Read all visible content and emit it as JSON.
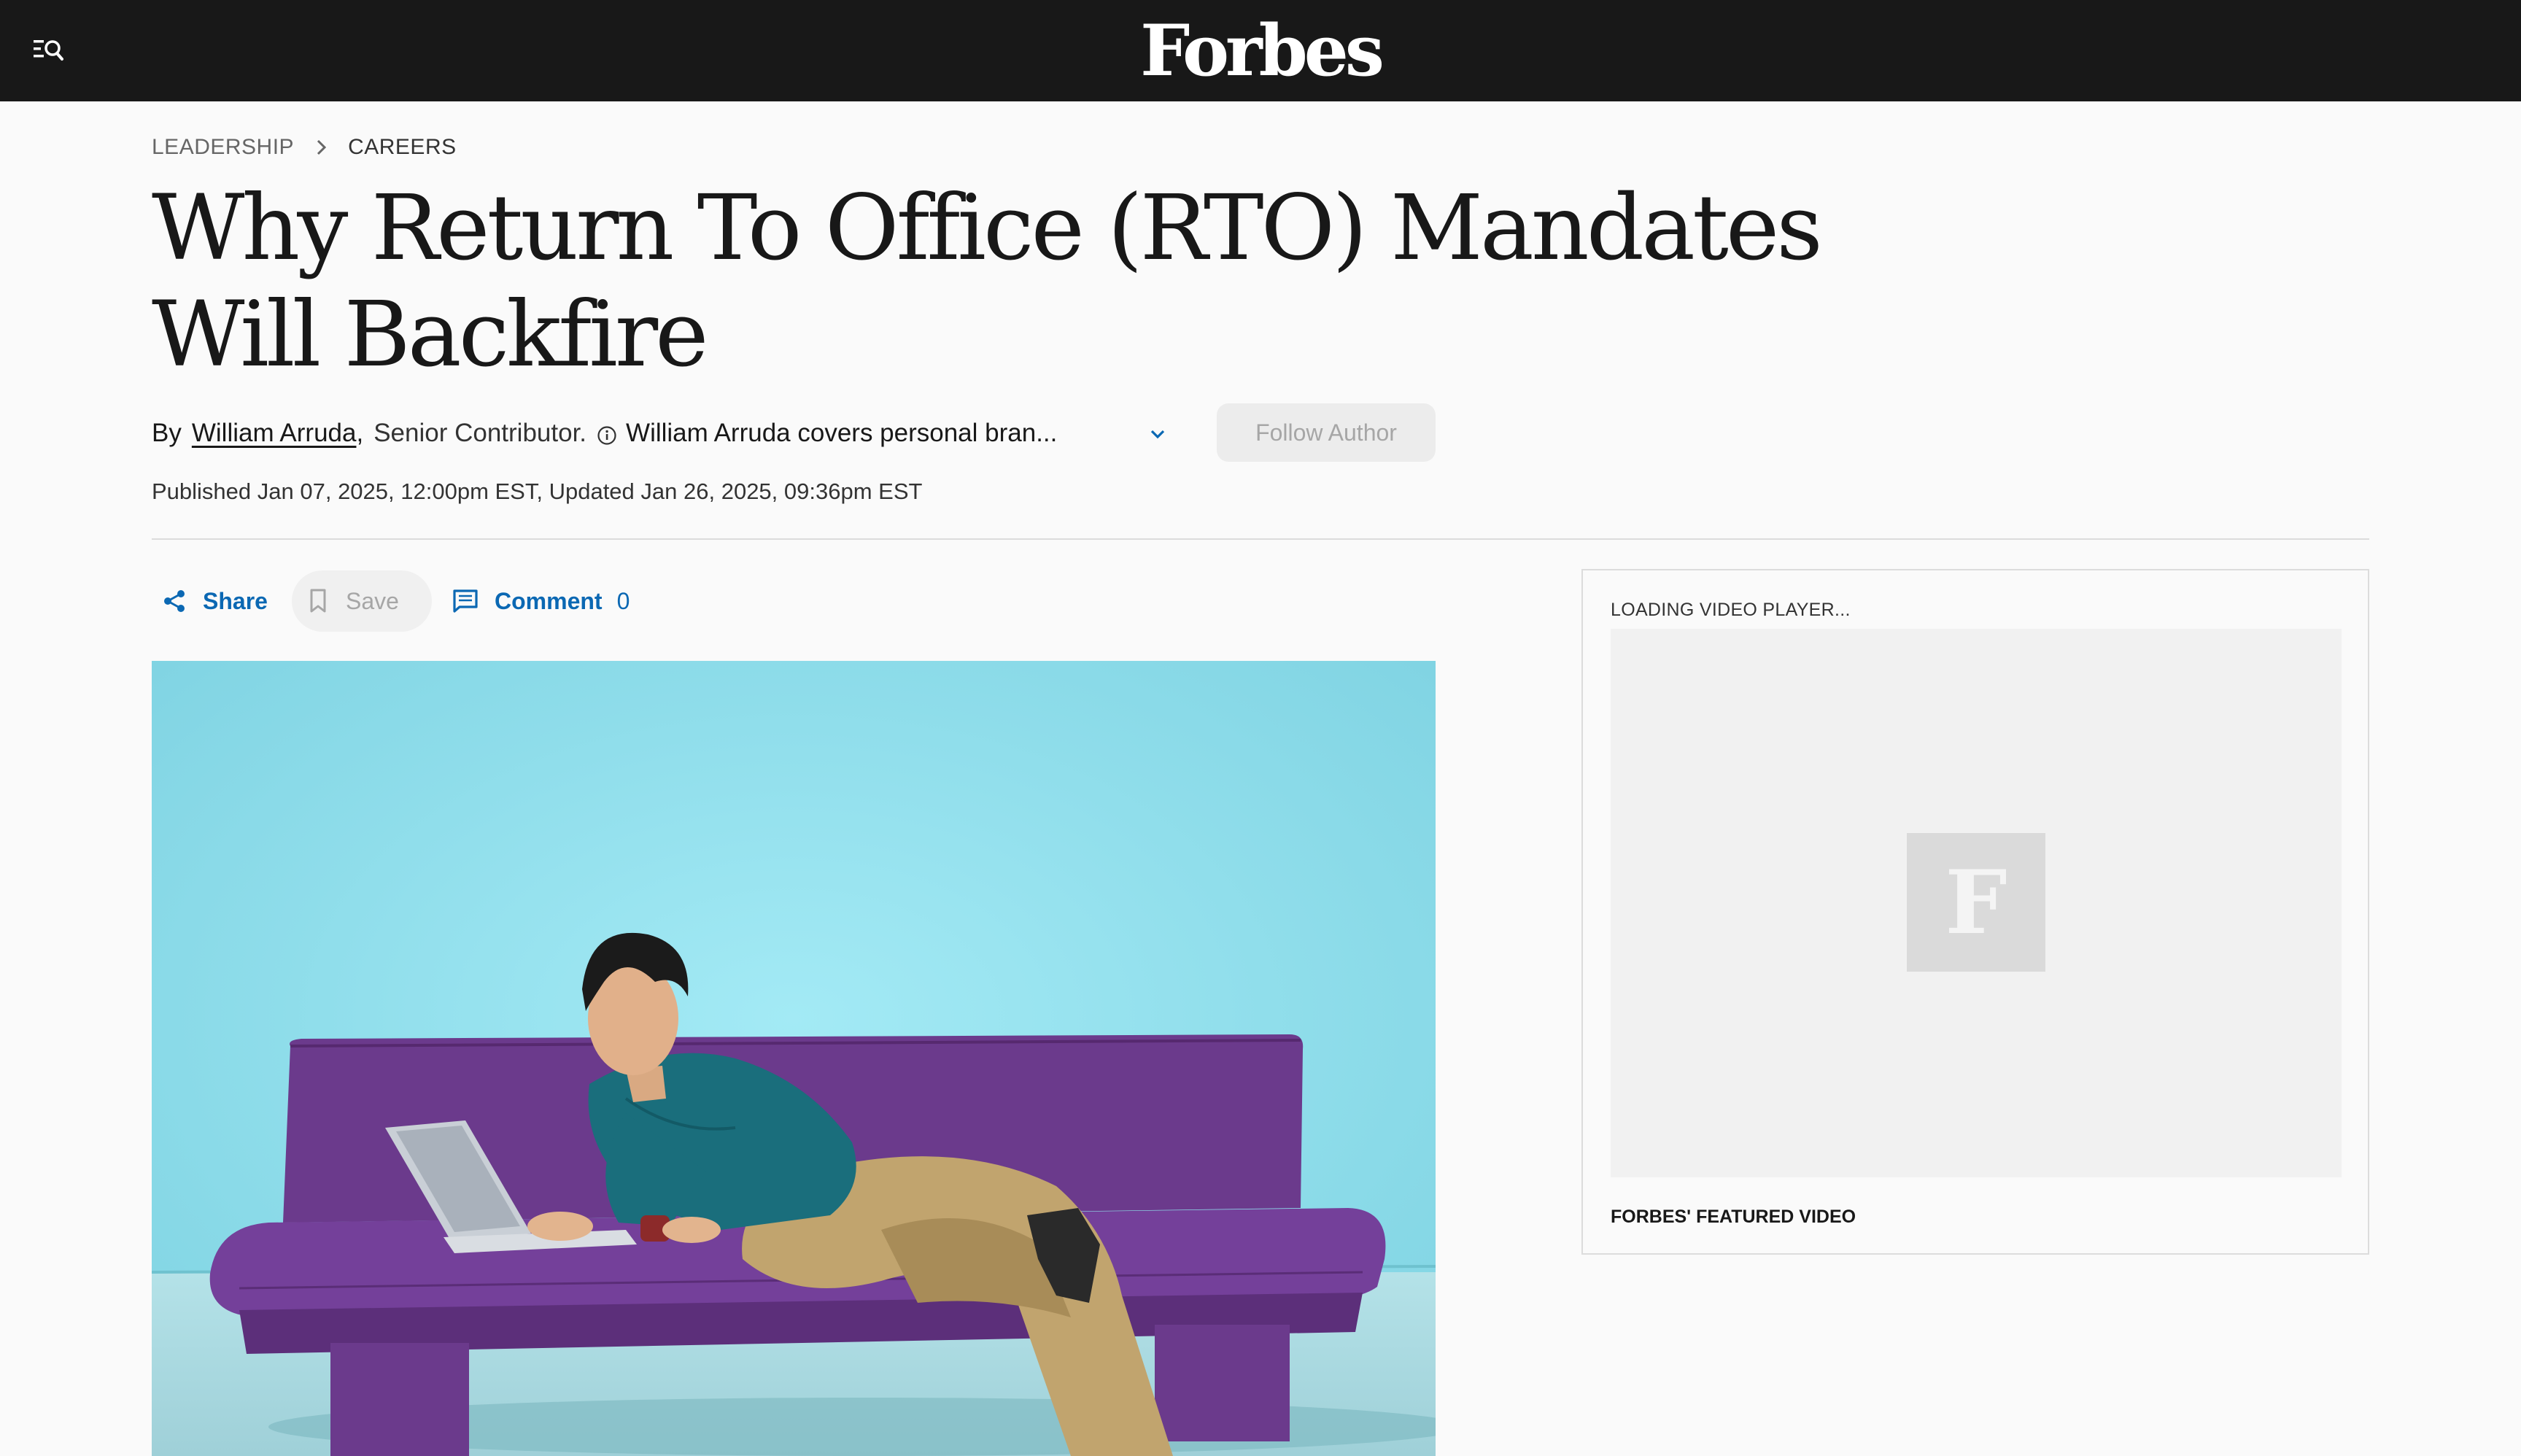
{
  "header": {
    "logo": "Forbes",
    "menu_icon": "menu-search-icon"
  },
  "breadcrumb": {
    "section": "LEADERSHIP",
    "subsection": "CAREERS",
    "separator_icon": "chevron-right-icon"
  },
  "article": {
    "title": "Why Return To Office (RTO) Mandates Will Backfire",
    "byline": {
      "by": "By",
      "author": "William Arruda",
      "comma": ",",
      "role": "Senior Contributor.",
      "bio": "William Arruda covers personal bran...",
      "expand_icon": "chevron-down-icon",
      "follow_label": "Follow Author"
    },
    "dates": "Published Jan 07, 2025, 12:00pm EST, Updated Jan 26, 2025, 09:36pm EST"
  },
  "actions": {
    "share_label": "Share",
    "save_label": "Save",
    "comment_label": "Comment",
    "comment_count": "0"
  },
  "sidebar": {
    "video": {
      "loading_text": "LOADING VIDEO PLAYER...",
      "logo_letter": "F",
      "caption": "FORBES' FEATURED VIDEO"
    }
  },
  "colors": {
    "topbar": "#181818",
    "link_blue": "#0b68b3",
    "hero_background": "#8fdfec",
    "sofa": "#6b3a8c"
  }
}
